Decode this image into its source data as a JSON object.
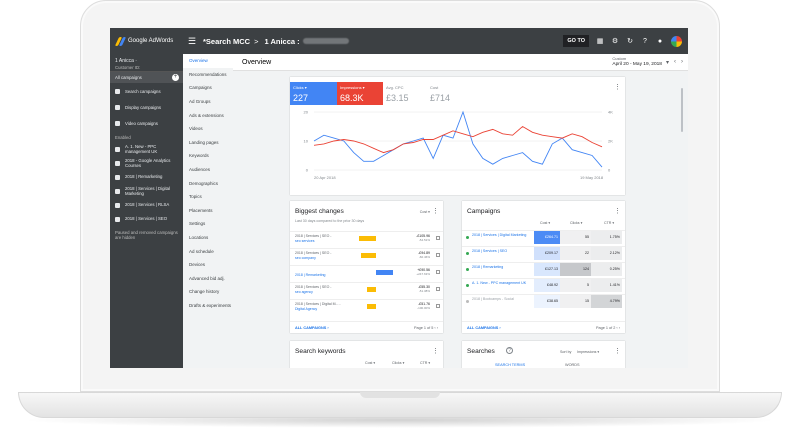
{
  "app": {
    "brand": "Google AdWords",
    "title": "*Search MCC",
    "crumb_sep": ">",
    "account": "1 Anicca :",
    "goto": "GO TO"
  },
  "account": {
    "name": "1 Anicca ·",
    "customer_id": "Customer ID:"
  },
  "darknav": {
    "all_campaigns": "All campaigns",
    "items": [
      {
        "label": "Search campaigns"
      },
      {
        "label": "Display campaigns"
      },
      {
        "label": "Video campaigns"
      }
    ],
    "enabled_label": "Enabled",
    "campaigns": [
      {
        "label": "A. 1. New - PPC management UK"
      },
      {
        "label": "2018 - Google Analytics Courses"
      },
      {
        "label": "2018 | Remarketing"
      },
      {
        "label": "2018 | Services | Digital Marketing"
      },
      {
        "label": "2018 | Services | RLSA"
      },
      {
        "label": "2018 | Services | SEO"
      }
    ],
    "footer": "Paused and removed campaigns are hidden"
  },
  "lightnav": [
    "Overview",
    "Recommendations",
    "Campaigns",
    "Ad Groups",
    "Ads & extensions",
    "Videos",
    "Landing pages",
    "Keywords",
    "Audiences",
    "Demographics",
    "Topics",
    "Placements",
    "Settings",
    "Locations",
    "Ad schedule",
    "Devices",
    "Advanced bid adj.",
    "Change history",
    "Drafts & experiments"
  ],
  "page": {
    "title": "Overview",
    "date_label": "Custom",
    "date_range": "April 20 - May 19, 2018"
  },
  "metrics": [
    {
      "label": "Clicks ▾",
      "value": "227",
      "color": "#4285f4"
    },
    {
      "label": "Impressions ▾",
      "value": "68.3K",
      "color": "#ea4335"
    },
    {
      "label": "Avg. CPC",
      "value": "£3.15"
    },
    {
      "label": "Cost",
      "value": "£714"
    }
  ],
  "chart_data": {
    "type": "line",
    "x": [
      "20 Apr 2018",
      "",
      "",
      "",
      "",
      "",
      "",
      "",
      "",
      "",
      "",
      "",
      "",
      "",
      "",
      "",
      "",
      "",
      "",
      "",
      "",
      "",
      "",
      "",
      "",
      "",
      "",
      "",
      "",
      "19 May 2018"
    ],
    "series": [
      {
        "name": "Clicks",
        "color": "#4285f4",
        "axis": "left",
        "values": [
          10,
          12,
          11,
          10,
          6,
          3,
          3,
          5,
          7,
          9,
          10,
          11,
          4,
          12,
          11,
          20,
          9,
          4,
          2,
          4,
          5,
          6,
          3,
          2,
          9,
          11,
          7,
          6,
          5,
          1
        ]
      },
      {
        "name": "Impressions",
        "color": "#ea4335",
        "axis": "right",
        "values": [
          1700,
          1800,
          2000,
          2100,
          2000,
          1800,
          1500,
          1200,
          1400,
          1800,
          1900,
          2100,
          2100,
          2400,
          2700,
          2500,
          2300,
          2600,
          2800,
          2500,
          2400,
          3000,
          2600,
          2400,
          2300,
          2200,
          2500,
          2300,
          1900,
          1600
        ]
      }
    ],
    "ylim_left": [
      0,
      20
    ],
    "ylim_right": [
      0,
      4000
    ],
    "left_ticks": [
      "20",
      "10",
      "0"
    ],
    "right_ticks": [
      "4K",
      "2K",
      "0"
    ],
    "start_label": "20 Apr 2018",
    "end_label": "19 May 2018"
  },
  "biggest_changes": {
    "title": "Biggest changes",
    "filter": "Cost ▾",
    "sub": "Last 30 days compared to the prior 30 days",
    "rows": [
      {
        "name": "2018 | Services | SEO - ",
        "link": "seo services",
        "val": "-£105.96",
        "pct": "-54.51%",
        "bar_color": "#fbbc05"
      },
      {
        "name": "2018 | Services | SEO - ",
        "link": "seo company",
        "val": "-£94.89",
        "pct": "-60.46%",
        "bar_color": "#fbbc05"
      },
      {
        "name": "",
        "link": "2018 | Remarketing",
        "val": "+£90.56",
        "pct": "+247.63%",
        "bar_color": "#4285f4"
      },
      {
        "name": "2018 | Services | SEO - ",
        "link": "seo agency",
        "val": "-£55.30",
        "pct": "-51.38%",
        "bar_color": "#fbbc05"
      },
      {
        "name": "2018 | Services | Digital M... - ",
        "link": "Digital Agency",
        "val": "-£51.76",
        "pct": "-100.00%",
        "bar_color": "#fbbc05"
      }
    ],
    "bar_levels": [
      0.55,
      0.5,
      0.55,
      0.3,
      0.3
    ],
    "footer_link": "ALL CAMPAIGNS ›",
    "pager": "Page 1 of 5  ‹  ›"
  },
  "campaigns": {
    "title": "Campaigns",
    "cols": [
      "Cost ▾",
      "Clicks ▾",
      "CTR ▾"
    ],
    "rows": [
      {
        "name": "2018 | Services | Digital Marketing",
        "cost": "£264.71",
        "clicks": "55",
        "ctr": "1.75%",
        "status": "green"
      },
      {
        "name": "2018 | Services | SEO",
        "cost": "£209.17",
        "clicks": "22",
        "ctr": "2.12%",
        "status": "green"
      },
      {
        "name": "2018 | Remarketing",
        "cost": "£127.13",
        "clicks": "124",
        "ctr": "0.25%",
        "status": "green"
      },
      {
        "name": "A. 1. New - PPC management UK",
        "cost": "£48.92",
        "clicks": "5",
        "ctr": "1.41%",
        "status": "green"
      },
      {
        "name": "2018 | Bootcamps - Social",
        "cost": "£38.65",
        "clicks": "15",
        "ctr": "4.79%",
        "status": "grey"
      }
    ],
    "footer_link": "ALL CAMPAIGNS ›",
    "pager": "Page 1 of 2  ‹  ›"
  },
  "search_keywords": {
    "title": "Search keywords",
    "cols": [
      "Cost ▾",
      "Clicks ▾",
      "CTR ▾"
    ]
  },
  "searches": {
    "title": "Searches",
    "sort_label": "Sort by",
    "sort_value": "Impressions ▾",
    "tabs": [
      "SEARCH TERMS",
      "WORDS"
    ]
  }
}
